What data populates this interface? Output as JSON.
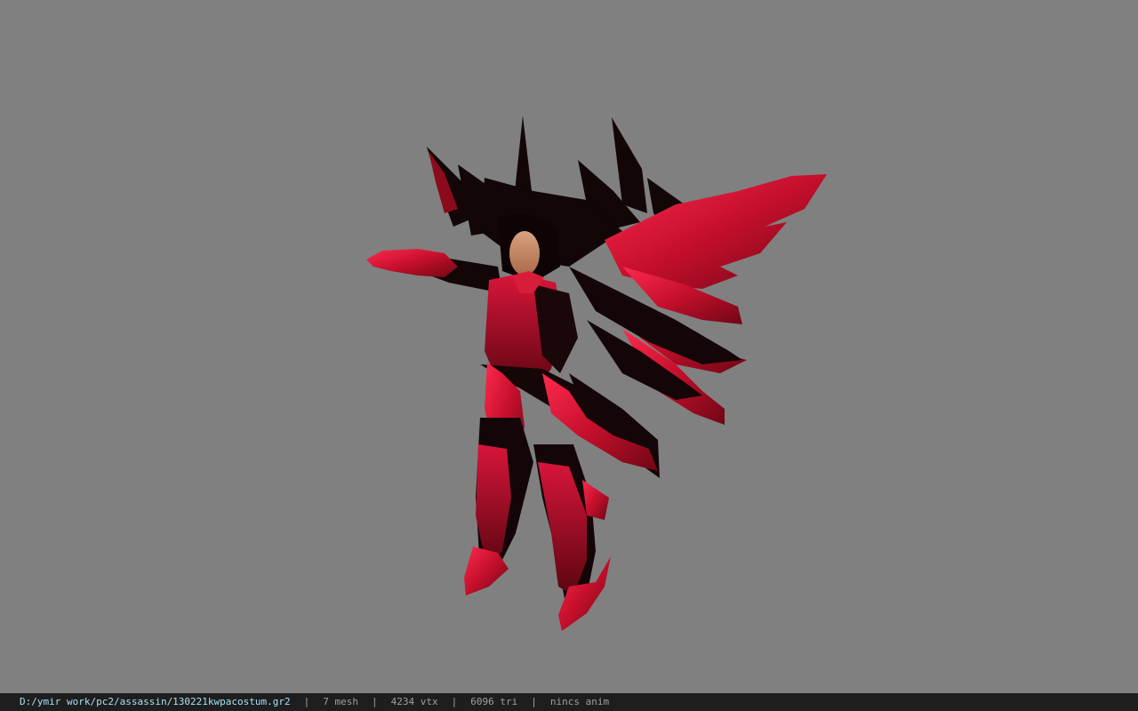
{
  "viewport": {
    "background": "#808080",
    "model_icon": "character-model"
  },
  "status_bar": {
    "file_path": "D:/ymir work/pc2/assassin/130221kwpacostum.gr2",
    "separator": "|",
    "mesh": "7 mesh",
    "vertices": "4234 vtx",
    "triangles": "6096 tri",
    "animation": "nincs anim",
    "colors": {
      "background": "#1e1e1e",
      "path": "#a6e1f5",
      "text": "#9aa0a6"
    }
  }
}
